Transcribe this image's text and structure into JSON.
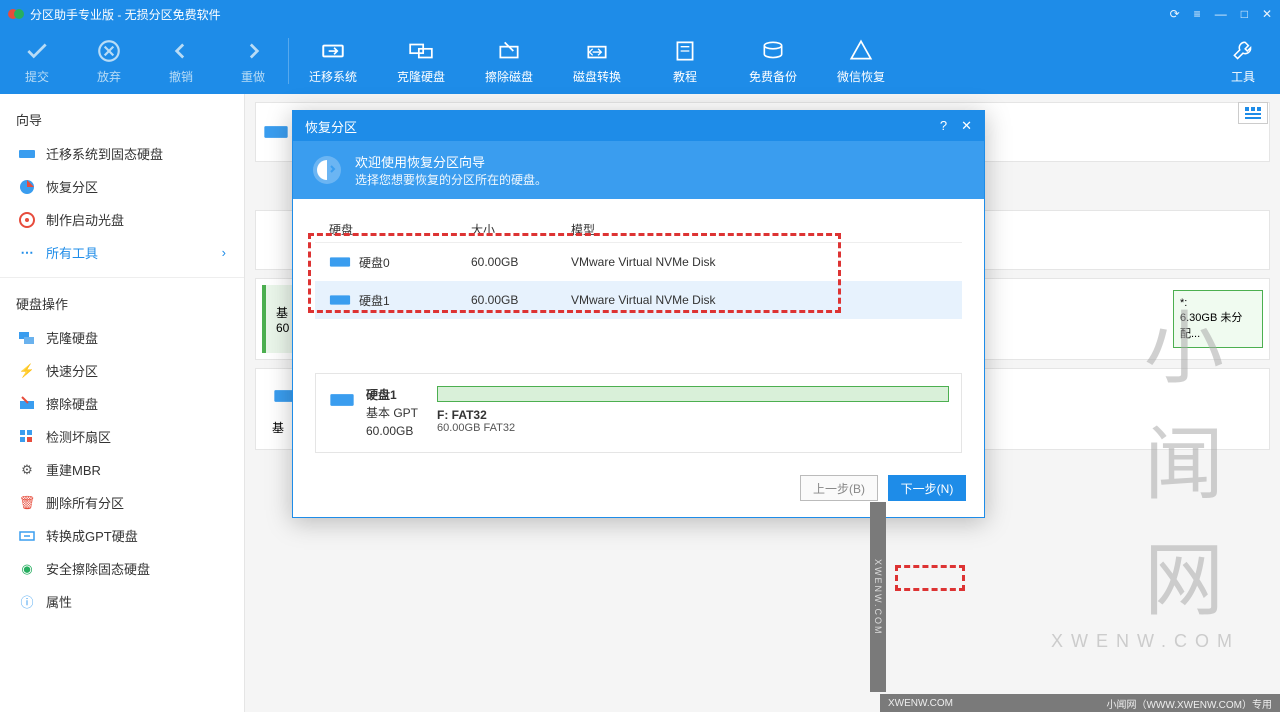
{
  "window": {
    "title": "分区助手专业版 - 无损分区免费软件"
  },
  "toolbar": {
    "commit": "提交",
    "discard": "放弃",
    "undo": "撤销",
    "redo": "重做",
    "migrate": "迁移系统",
    "clone": "克隆硬盘",
    "wipe": "擦除磁盘",
    "convert": "磁盘转换",
    "tutorial": "教程",
    "backup": "免费备份",
    "wxrecover": "微信恢复",
    "tools": "工具"
  },
  "sidebar": {
    "wizard_title": "向导",
    "wizard": [
      {
        "label": "迁移系统到固态硬盘"
      },
      {
        "label": "恢复分区"
      },
      {
        "label": "制作启动光盘"
      }
    ],
    "all_tools": "所有工具",
    "ops_title": "硬盘操作",
    "ops": [
      {
        "label": "克隆硬盘"
      },
      {
        "label": "快速分区"
      },
      {
        "label": "擦除硬盘"
      },
      {
        "label": "检测坏扇区"
      },
      {
        "label": "重建MBR"
      },
      {
        "label": "删除所有分区"
      },
      {
        "label": "转换成GPT硬盘"
      },
      {
        "label": "安全擦除固态硬盘"
      },
      {
        "label": "属性"
      }
    ]
  },
  "dialog": {
    "title": "恢复分区",
    "banner_title": "欢迎使用恢复分区向导",
    "banner_sub": "选择您想要恢复的分区所在的硬盘。",
    "headers": {
      "disk": "硬盘",
      "size": "大小",
      "model": "模型"
    },
    "rows": [
      {
        "name": "硬盘0",
        "size": "60.00GB",
        "model": "VMware Virtual NVMe Disk"
      },
      {
        "name": "硬盘1",
        "size": "60.00GB",
        "model": "VMware Virtual NVMe Disk"
      }
    ],
    "preview": {
      "disk_name": "硬盘1",
      "disk_type": "基本 GPT",
      "disk_size": "60.00GB",
      "part_label": "F: FAT32",
      "part_sub": "60.00GB FAT32"
    },
    "btn_prev": "上一步(B)",
    "btn_next": "下一步(N)"
  },
  "main": {
    "unalloc_label": "*:",
    "unalloc_sub": "6.30GB 未分配...",
    "left_card_prefix": "基",
    "left_card_size": "60"
  },
  "watermark": {
    "big": "小闻网",
    "sub": "XWENW.COM",
    "barL": "XWENW.COM",
    "barR": "小闻网（WWW.XWENW.COM）专用"
  }
}
